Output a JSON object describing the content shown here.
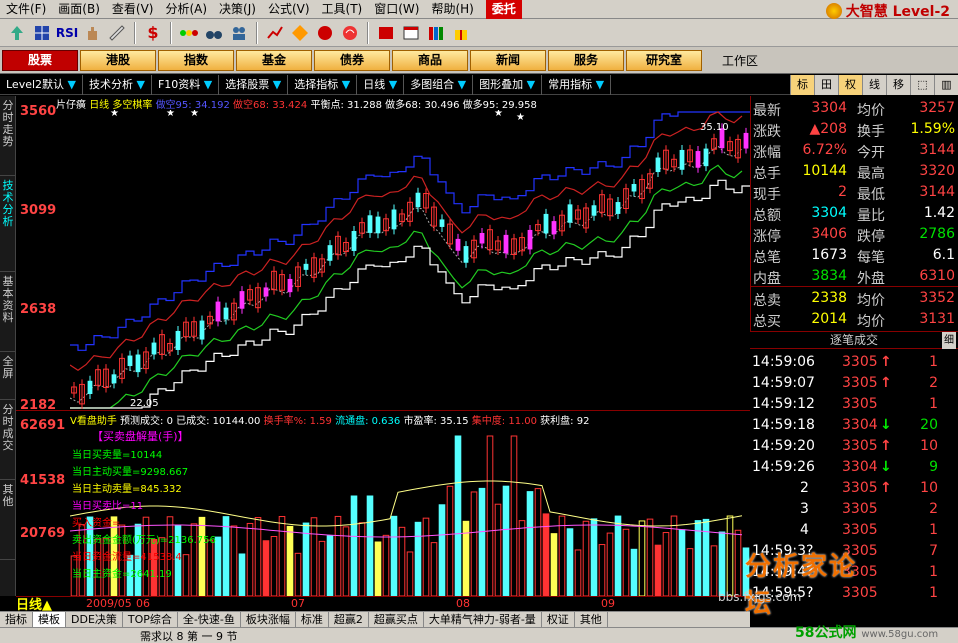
{
  "menu": {
    "items": [
      "文件(F)",
      "画面(B)",
      "查看(V)",
      "分析(A)",
      "决策(J)",
      "公式(V)",
      "工具(T)",
      "窗口(W)",
      "帮助(H)"
    ],
    "entrust": "委托",
    "brand": "大智慧 Level-2"
  },
  "sections": [
    "股票",
    "港股",
    "指数",
    "基金",
    "债券",
    "商品",
    "新闻",
    "服务",
    "研究室"
  ],
  "workzone": "工作区",
  "subbar": [
    "Level2默认",
    "技术分析",
    "F10资料",
    "选择股票",
    "选择指标",
    "日线",
    "多图组合",
    "图形叠加",
    "常用指标"
  ],
  "right_tabs": [
    "标",
    "田",
    "权",
    "线",
    "移",
    "⬚",
    "▥"
  ],
  "left_tabs": [
    "分时走势",
    "技术分析",
    "基本资料",
    "全屏",
    "分时成交",
    "其他"
  ],
  "chart": {
    "info": {
      "name": "片仔癀",
      "period": "日线",
      "indicator": "多空棋率",
      "items": [
        {
          "label": "做空95:",
          "value": "34.192",
          "cls": "b"
        },
        {
          "label": "做空68:",
          "value": "33.424",
          "cls": "r"
        },
        {
          "label": "平衡点:",
          "value": "31.288",
          "cls": "w"
        },
        {
          "label": "做多68:",
          "value": "30.496",
          "cls": "g"
        },
        {
          "label": "做多95:",
          "value": "29.958",
          "cls": "w"
        }
      ]
    },
    "y_labels": [
      "3560",
      "3099",
      "2638",
      "2182"
    ],
    "annotations": [
      "35.10",
      "22.05"
    ],
    "vol_info": {
      "title": "V看盘助手",
      "items": [
        "预测成交: 0",
        "已成交: 10144.00",
        "换手率%: 1.59",
        "流通盘: 0.636",
        "市盈率: 35.15",
        "集中度: 11.00",
        "获利盘: 92"
      ]
    },
    "vol_y_labels": [
      "62691",
      "41538",
      "20769"
    ],
    "overlay_title": "【买卖盘解量(手)】",
    "overlay_lines": [
      {
        "text": "当日买卖量=10144",
        "color": "#00ff00"
      },
      {
        "text": "当日主动买量=9298.667",
        "color": "#00ff00"
      },
      {
        "text": "当日主动卖量=845.332",
        "color": "#ffff00"
      },
      {
        "text": "当日买卖比=11",
        "color": "#ff00ff"
      },
      {
        "text": "买入资金=",
        "color": "#ff0000"
      },
      {
        "text": "卖出资金金额(万元)=2136.756",
        "color": "#00ff00"
      },
      {
        "text": "当日资金流量=41538.4",
        "color": "#ff0000"
      },
      {
        "text": "当日主资金=2641.19",
        "color": "#00ff00"
      }
    ],
    "dates": [
      "2009/05",
      "06",
      "07",
      "08",
      "09"
    ],
    "period_label": "日线"
  },
  "bottom_tabs": [
    "指标",
    "模板",
    "DDE决策",
    "TOP综合",
    "全-快速-鱼",
    "板块涨幅",
    "标准",
    "超赢2",
    "超赢买点",
    "大单精气神力-弱者-量",
    "权证",
    "其他"
  ],
  "bottom_strip": "需求以 8 第 一 9 节",
  "quote": {
    "rows": [
      {
        "l1": "最新",
        "v1": "3304",
        "c1": "red",
        "l2": "均价",
        "v2": "3257",
        "c2": "red"
      },
      {
        "l1": "涨跌",
        "v1": "▲208",
        "c1": "red",
        "l2": "换手",
        "v2": "1.59%",
        "c2": "yellow"
      },
      {
        "l1": "涨幅",
        "v1": "6.72%",
        "c1": "red",
        "l2": "今开",
        "v2": "3144",
        "c2": "red"
      },
      {
        "l1": "总手",
        "v1": "10144",
        "c1": "yellow",
        "l2": "最高",
        "v2": "3320",
        "c2": "red"
      },
      {
        "l1": "现手",
        "v1": "2",
        "c1": "red",
        "l2": "最低",
        "v2": "3144",
        "c2": "red"
      },
      {
        "l1": "总额",
        "v1": "3304",
        "c1": "cyan",
        "l2": "量比",
        "v2": "1.42",
        "c2": "white"
      },
      {
        "l1": "涨停",
        "v1": "3406",
        "c1": "red",
        "l2": "跌停",
        "v2": "2786",
        "c2": "green"
      },
      {
        "l1": "总笔",
        "v1": "1673",
        "c1": "white",
        "l2": "每笔",
        "v2": "6.1",
        "c2": "white"
      },
      {
        "l1": "内盘",
        "v1": "3834",
        "c1": "green",
        "l2": "外盘",
        "v2": "6310",
        "c2": "red"
      },
      {
        "l1": "总卖",
        "v1": "2338",
        "c1": "yellow",
        "l2": "均价",
        "v2": "3352",
        "c2": "red"
      },
      {
        "l1": "总买",
        "v1": "2014",
        "c1": "yellow",
        "l2": "均价",
        "v2": "3131",
        "c2": "red"
      }
    ],
    "ticks_title": "逐笔成交",
    "ticks_fine": "细",
    "ticks": [
      {
        "time": "14:59:06",
        "price": "3305",
        "dir": "up",
        "vol": "1",
        "vc": "red"
      },
      {
        "time": "14:59:07",
        "price": "3305",
        "dir": "up",
        "vol": "2",
        "vc": "red"
      },
      {
        "time": "14:59:12",
        "price": "3305",
        "dir": "",
        "vol": "1",
        "vc": "red"
      },
      {
        "time": "14:59:18",
        "price": "3304",
        "dir": "down",
        "vol": "20",
        "vc": "green"
      },
      {
        "time": "14:59:20",
        "price": "3305",
        "dir": "up",
        "vol": "10",
        "vc": "red"
      },
      {
        "time": "14:59:26",
        "price": "3304",
        "dir": "down",
        "vol": "9",
        "vc": "green"
      },
      {
        "time": "2",
        "price": "3305",
        "dir": "up",
        "vol": "10",
        "vc": "red"
      },
      {
        "time": "3",
        "price": "3305",
        "dir": "",
        "vol": "2",
        "vc": "red"
      },
      {
        "time": "4",
        "price": "3305",
        "dir": "",
        "vol": "1",
        "vc": "red"
      },
      {
        "time": "14:59:3?",
        "price": "3305",
        "dir": "",
        "vol": "7",
        "vc": "red"
      },
      {
        "time": "14:59:4?",
        "price": "3305",
        "dir": "",
        "vol": "1",
        "vc": "red"
      },
      {
        "time": "14:59:5?",
        "price": "3305",
        "dir": "",
        "vol": "1",
        "vc": "red"
      }
    ]
  },
  "watermark": {
    "text": "分析家论坛",
    "url": "bbs.fxjgs.com",
    "site": "58公式网",
    "site_url": "www.58gu.com"
  }
}
